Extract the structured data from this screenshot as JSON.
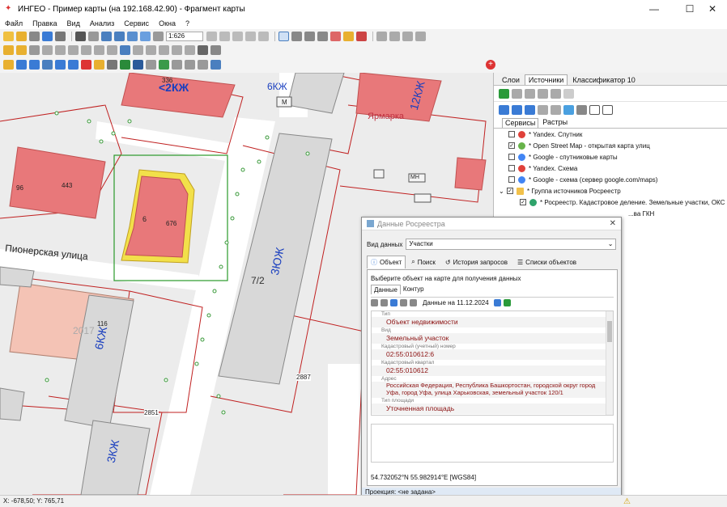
{
  "window": {
    "title": "ИНГЕО - Пример карты (на 192.168.42.90) - Фрагмент карты"
  },
  "menu": [
    "Файл",
    "Правка",
    "Вид",
    "Анализ",
    "Сервис",
    "Окна",
    "?"
  ],
  "toolbar": {
    "scale_value": "1:626"
  },
  "map": {
    "labels": [
      {
        "id": "street",
        "text": "Пионерская улица"
      },
      {
        "id": "b1",
        "text": "<2КЖ"
      },
      {
        "id": "b2",
        "text": "6КЖ"
      },
      {
        "id": "b3",
        "text": "12КЖ"
      },
      {
        "id": "b4",
        "text": "Ярмарка"
      },
      {
        "id": "b5",
        "text": "3ЮЖ"
      },
      {
        "id": "b6",
        "text": "7/2"
      },
      {
        "id": "b7",
        "text": "6КЖ"
      },
      {
        "id": "b8",
        "text": "3КЖ"
      },
      {
        "id": "b9",
        "text": "2851"
      },
      {
        "id": "b10",
        "text": "2887"
      },
      {
        "id": "b11",
        "text": "2017"
      },
      {
        "id": "b12",
        "text": "116"
      },
      {
        "id": "b13",
        "text": "443"
      },
      {
        "id": "b14",
        "text": "96"
      },
      {
        "id": "b15",
        "text": "676"
      },
      {
        "id": "b16",
        "text": "6"
      },
      {
        "id": "b17",
        "text": "М"
      },
      {
        "id": "b18",
        "text": "МН"
      },
      {
        "id": "b19",
        "text": "336"
      }
    ]
  },
  "status": {
    "coords": "X: -678,50; Y: 765,71"
  },
  "right_panel": {
    "tabs": [
      "Слои",
      "Источники",
      "Классификатор 10"
    ],
    "active_tab": "Источники",
    "subtabs": [
      "Сервисы",
      "Растры"
    ],
    "sources": [
      {
        "label": "* Yandex. Спутник",
        "checked": false,
        "icon_color": "#e0413a"
      },
      {
        "label": "* Open Street Map - открытая карта улиц",
        "checked": true,
        "icon_color": "#67b34a"
      },
      {
        "label": "* Google - спутниковые карты",
        "checked": false,
        "icon_color": "#4285f4"
      },
      {
        "label": "* Yandex. Схема",
        "checked": false,
        "icon_color": "#e0413a"
      },
      {
        "label": "* Google - схема (сервер google.com/maps)",
        "checked": false,
        "icon_color": "#4285f4"
      },
      {
        "label": "* Группа источников Росреестр",
        "checked": true,
        "icon_color": "#f2c14a"
      },
      {
        "label": "* Росреестр. Кадастровое деление. Земельные участки, ОКС",
        "checked": true,
        "icon_color": "#2fa36b"
      },
      {
        "label": "...ва ГКН",
        "checked": false,
        "icon_color": "#bbbbbb"
      }
    ]
  },
  "dialog": {
    "title": "Данные Росреестра",
    "view_label": "Вид данных",
    "view_value": "Участки",
    "tabs": [
      "Объект",
      "Поиск",
      "История запросов",
      "Списки объектов"
    ],
    "hint": "Выберите объект на карте для получения данных",
    "inner_tabs": [
      "Данные",
      "Контур"
    ],
    "date_label": "Данные на 11.12.2024",
    "props": {
      "type_label": "Тип",
      "type_value": "Объект недвижимости",
      "kind_label": "Вид",
      "kind_value": "Земельный участок",
      "cad_label": "Кадастровый (учетный) номер",
      "cad_value": "02:55:010612:6",
      "quarter_label": "Кадастровый квартал",
      "quarter_value": "02:55:010612",
      "address_label": "Адрес",
      "address_value": "Российская Федерация, Республика Башкортостан, городской округ город Уфа, город Уфа, улица Харьковская, земельный участок 120/1",
      "area_type_label": "Тип площади",
      "area_type_value": "Уточненная площадь"
    },
    "coords": "54.732052°N 55.982914°E [WGS84]",
    "projection": "Проекция: <не задана>"
  }
}
